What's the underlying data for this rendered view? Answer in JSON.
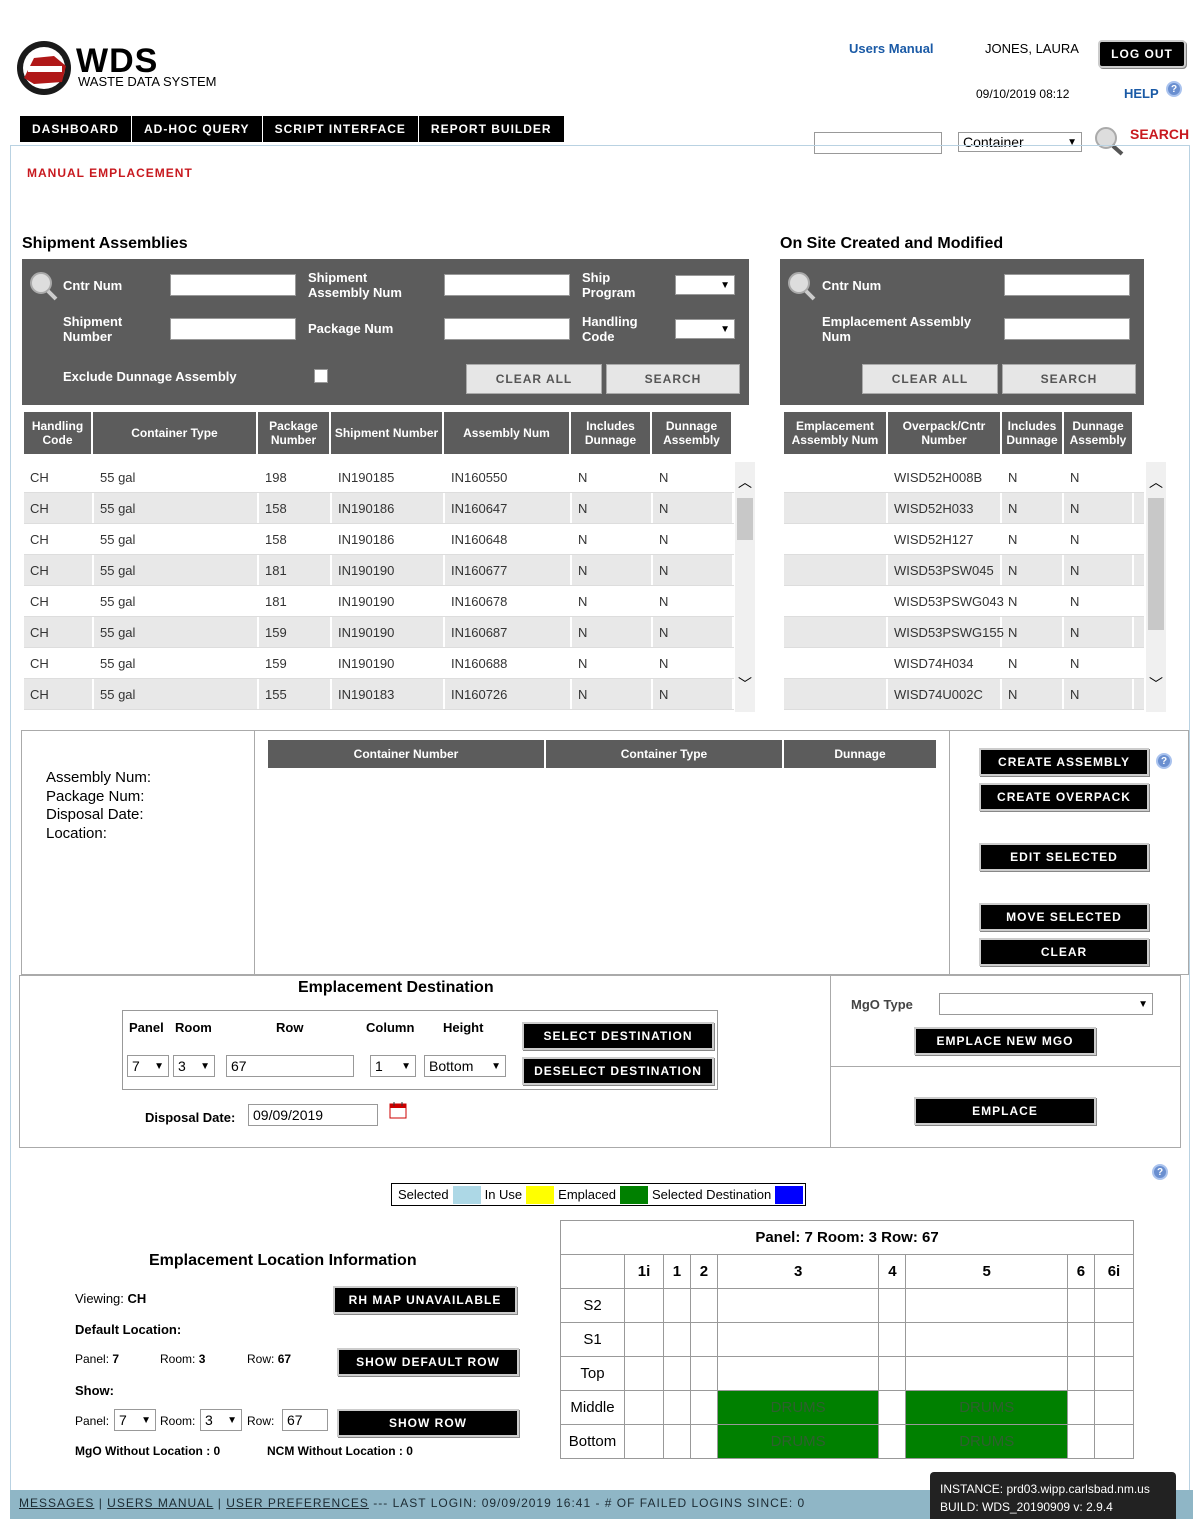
{
  "header": {
    "logo_title": "WDS",
    "logo_sub": "WASTE DATA SYSTEM",
    "users_manual": "Users Manual",
    "user": "JONES, LAURA",
    "logout": "LOG OUT",
    "datetime": "09/10/2019 08:12",
    "help": "HELP"
  },
  "nav": [
    "DASHBOARD",
    "AD-HOC QUERY",
    "SCRIPT INTERFACE",
    "REPORT BUILDER"
  ],
  "search": {
    "type": "Container",
    "label": "SEARCH"
  },
  "page_title": "MANUAL EMPLACEMENT",
  "shipment": {
    "heading": "Shipment Assemblies",
    "f_cntr": "Cntr Num",
    "f_sa": "Shipment Assembly Num",
    "f_ship": "Ship Program",
    "f_sn": "Shipment Number",
    "f_pkg": "Package Num",
    "f_handling": "Handling Code",
    "f_exclude": "Exclude Dunnage Assembly",
    "clear": "CLEAR ALL",
    "search": "SEARCH",
    "columns": [
      "Handling Code",
      "Container Type",
      "Package Number",
      "Shipment Number",
      "Assembly Num",
      "Includes Dunnage",
      "Dunnage Assembly"
    ],
    "rows": [
      [
        "CH",
        "55 gal",
        "198",
        "IN190185",
        "IN160550",
        "N",
        "N"
      ],
      [
        "CH",
        "55 gal",
        "158",
        "IN190186",
        "IN160647",
        "N",
        "N"
      ],
      [
        "CH",
        "55 gal",
        "158",
        "IN190186",
        "IN160648",
        "N",
        "N"
      ],
      [
        "CH",
        "55 gal",
        "181",
        "IN190190",
        "IN160677",
        "N",
        "N"
      ],
      [
        "CH",
        "55 gal",
        "181",
        "IN190190",
        "IN160678",
        "N",
        "N"
      ],
      [
        "CH",
        "55 gal",
        "159",
        "IN190190",
        "IN160687",
        "N",
        "N"
      ],
      [
        "CH",
        "55 gal",
        "159",
        "IN190190",
        "IN160688",
        "N",
        "N"
      ],
      [
        "CH",
        "55 gal",
        "155",
        "IN190183",
        "IN160726",
        "N",
        "N"
      ]
    ]
  },
  "onsite": {
    "heading": "On Site Created and Modified",
    "f_cntr": "Cntr Num",
    "f_ea": "Emplacement Assembly Num",
    "clear": "CLEAR ALL",
    "search": "SEARCH",
    "columns": [
      "Emplacement Assembly Num",
      "Overpack/Cntr Number",
      "Includes Dunnage",
      "Dunnage Assembly"
    ],
    "rows": [
      [
        "",
        "WISD52H008B",
        "N",
        "N"
      ],
      [
        "",
        "WISD52H033",
        "N",
        "N"
      ],
      [
        "",
        "WISD52H127",
        "N",
        "N"
      ],
      [
        "",
        "WISD53PSW045",
        "N",
        "N"
      ],
      [
        "",
        "WISD53PSWG043",
        "N",
        "N"
      ],
      [
        "",
        "WISD53PSWG155",
        "N",
        "N"
      ],
      [
        "",
        "WISD74H034",
        "N",
        "N"
      ],
      [
        "",
        "WISD74U002C",
        "N",
        "N"
      ]
    ]
  },
  "assembly": {
    "assembly_num": "Assembly Num:",
    "package_num": "Package Num:",
    "disposal_date": "Disposal Date:",
    "location": "Location:",
    "columns": [
      "Container Number",
      "Container Type",
      "Dunnage"
    ],
    "create_assembly": "CREATE ASSEMBLY",
    "create_overpack": "CREATE OVERPACK",
    "edit_selected": "EDIT SELECTED",
    "move_selected": "MOVE SELECTED",
    "clear": "CLEAR"
  },
  "destination": {
    "heading": "Emplacement Destination",
    "panel_lbl": "Panel",
    "room_lbl": "Room",
    "row_lbl": "Row",
    "column_lbl": "Column",
    "height_lbl": "Height",
    "panel": "7",
    "room": "3",
    "row": "67",
    "column": "1",
    "height": "Bottom",
    "select": "SELECT DESTINATION",
    "deselect": "DESELECT DESTINATION",
    "disposal_lbl": "Disposal Date:",
    "disposal": "09/09/2019",
    "mgo_type": "MgO Type",
    "emplace_mgo": "EMPLACE NEW MGO",
    "emplace": "EMPLACE"
  },
  "legend": {
    "selected": "Selected",
    "in_use": "In Use",
    "emplaced": "Emplaced",
    "selected_dest": "Selected Destination",
    "c_selected": "#add8e6",
    "c_inuse": "#ffff00",
    "c_emplaced": "#008000",
    "c_dest": "#0000ff"
  },
  "location": {
    "heading": "Emplacement Location Information",
    "viewing_lbl": "Viewing:",
    "viewing": "CH",
    "rh_map": "RH MAP UNAVAILABLE",
    "default_loc": "Default Location:",
    "panel_lbl": "Panel:",
    "room_lbl": "Room:",
    "row_lbl": "Row:",
    "d_panel": "7",
    "d_room": "3",
    "d_row": "67",
    "show_default": "SHOW DEFAULT ROW",
    "show": "Show:",
    "s_panel": "7",
    "s_room": "3",
    "s_row": "67",
    "show_row": "SHOW ROW",
    "mgo": "MgO Without Location : 0",
    "ncm": "NCM Without Location : 0"
  },
  "grid": {
    "title": "Panel: 7 Room: 3 Row: 67",
    "cols": [
      "1i",
      "1",
      "2",
      "3",
      "4",
      "5",
      "6",
      "6i"
    ],
    "rows": [
      "S2",
      "S1",
      "Top",
      "Middle",
      "Bottom"
    ],
    "drums": "DRUMS"
  },
  "footer": {
    "messages": "MESSAGES",
    "users_manual": "USERS MANUAL",
    "prefs": "USER PREFERENCES",
    "rest": "--- LAST LOGIN: 09/09/2019 16:41 - # OF FAILED LOGINS SINCE: 0",
    "instance": "INSTANCE: prd03.wipp.carlsbad.nm.us",
    "build": "BUILD: WDS_20190909 v: 2.9.4"
  }
}
